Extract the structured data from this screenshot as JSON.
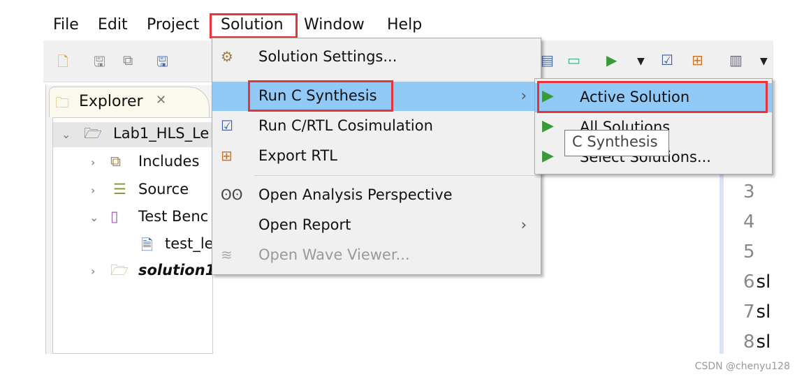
{
  "menubar": {
    "items": [
      "File",
      "Edit",
      "Project",
      "Solution",
      "Window",
      "Help"
    ]
  },
  "explorer": {
    "tab_label": "Explorer",
    "tree": [
      {
        "label": "Lab1_HLS_Le",
        "icon": "project-folder-icon",
        "expanded": true
      },
      {
        "label": "Includes",
        "icon": "includes-icon",
        "expanded": false
      },
      {
        "label": "Source",
        "icon": "source-icon",
        "expanded": false
      },
      {
        "label": "Test Benc",
        "icon": "testbench-icon",
        "expanded": true
      },
      {
        "label": "test_le",
        "icon": "c-file-icon"
      },
      {
        "label": "solution1",
        "icon": "solution-folder-icon",
        "expanded": false
      }
    ]
  },
  "solution_menu": {
    "items": [
      {
        "label": "Solution Settings...",
        "icon": "settings-icon"
      },
      {
        "label": "Run C Synthesis",
        "icon": "",
        "submenu": true,
        "highlighted": true
      },
      {
        "label": "Run C/RTL Cosimulation",
        "icon": "checkbox-icon"
      },
      {
        "label": "Export RTL",
        "icon": "export-rtl-icon"
      },
      {
        "label": "Open Analysis Perspective",
        "icon": "glasses-icon"
      },
      {
        "label": "Open Report",
        "icon": "",
        "submenu": true
      },
      {
        "label": "Open Wave Viewer...",
        "icon": "wave-icon",
        "disabled": true
      }
    ]
  },
  "synthesis_submenu": {
    "items": [
      {
        "label": "Active Solution",
        "highlighted": true
      },
      {
        "label": "All Solutions"
      },
      {
        "label": "Select Solutions..."
      }
    ]
  },
  "tooltip": "C Synthesis",
  "editor": {
    "lines": [
      {
        "n": "3",
        "t": ""
      },
      {
        "n": "4",
        "t": ""
      },
      {
        "n": "5",
        "t": ""
      },
      {
        "n": "6",
        "t": "sl"
      },
      {
        "n": "7",
        "t": "sl"
      },
      {
        "n": "8",
        "t": "sl"
      }
    ]
  },
  "watermark": "CSDN @chenyu128",
  "colors": {
    "highlight": "#91c9f7",
    "annotation_red": "#e8333a",
    "run_green": "#3a9a3a"
  }
}
